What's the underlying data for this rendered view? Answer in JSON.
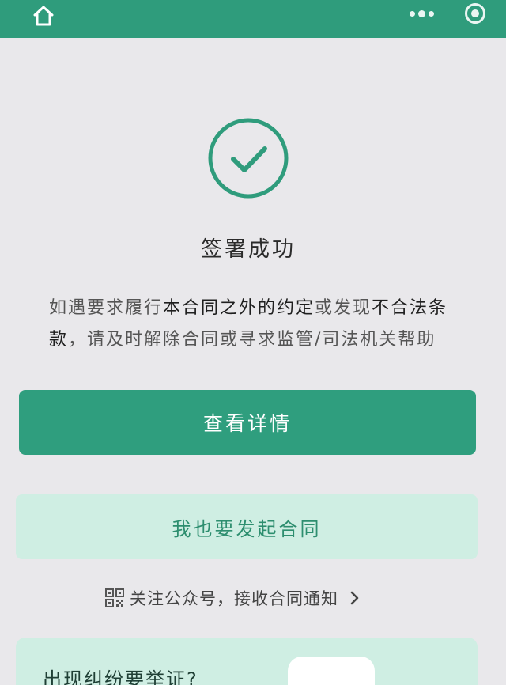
{
  "colors": {
    "brand": "#2f9c7c",
    "primary_button": "#2f9e7e",
    "secondary_button": "#cfeee3",
    "background": "#e9e8eb"
  },
  "header": {
    "home_icon": "home-icon",
    "more_icon": "more-dots-icon",
    "close_icon": "target-close-icon"
  },
  "result": {
    "icon": "check-circle-icon",
    "title": "签署成功",
    "notice_parts": [
      "如遇要求履行",
      "本合同之外的约定",
      "或发现",
      "不合法条款",
      "，请及时解除合同或寻求监管/司法机关帮助"
    ]
  },
  "actions": {
    "view_details": "查看详情",
    "start_contract": "我也要发起合同"
  },
  "follow": {
    "icon": "qr-code-icon",
    "label": "关注公众号，接收合同通知",
    "arrow": "chevron-right-icon"
  },
  "bottom_card": {
    "label": "出现纠纷要举证?"
  }
}
